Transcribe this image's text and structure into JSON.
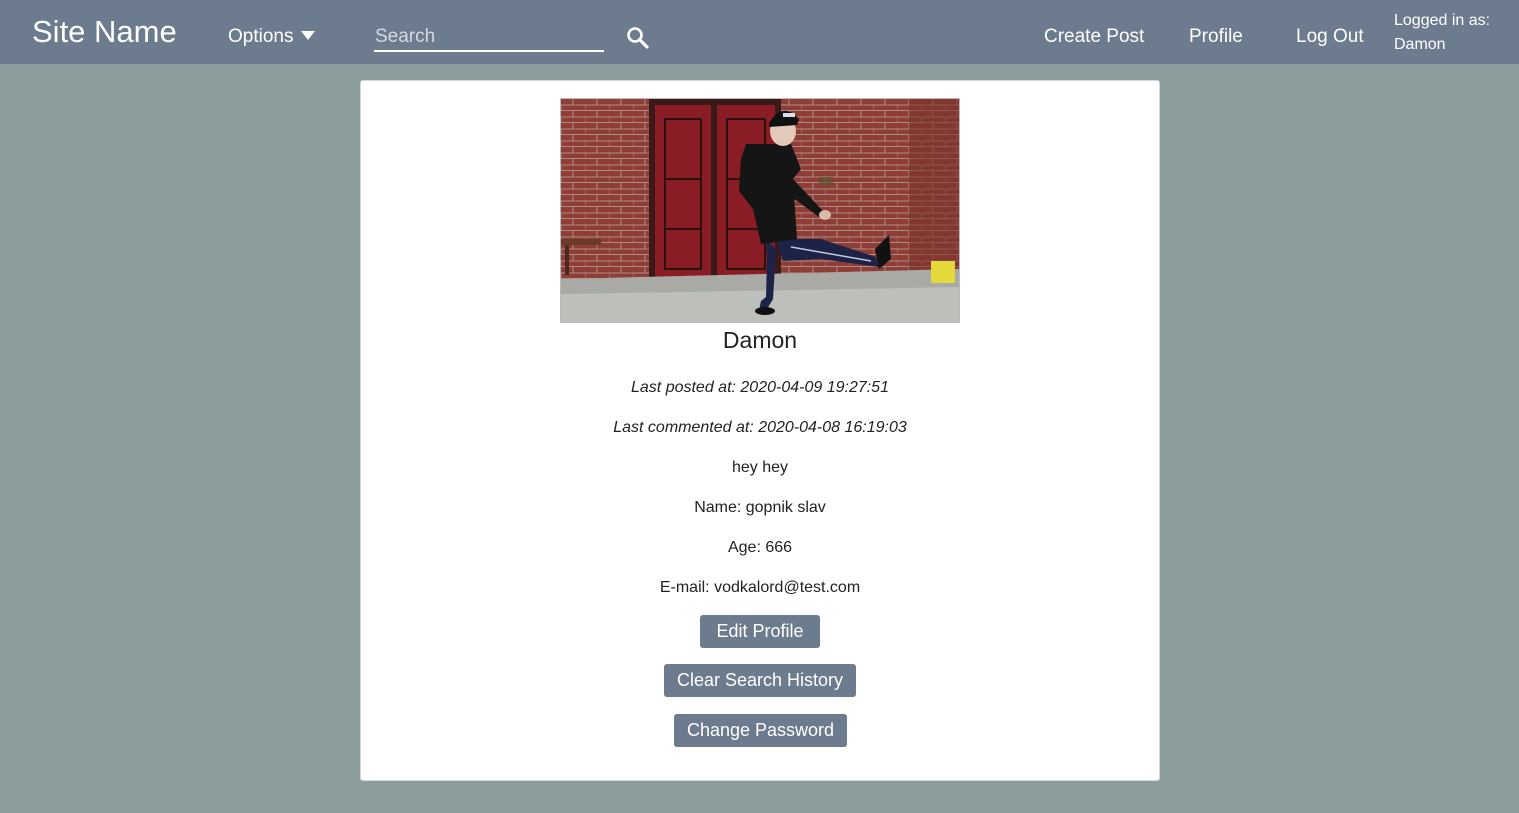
{
  "nav": {
    "brand": "Site Name",
    "options_label": "Options",
    "search_placeholder": "Search",
    "create_post": "Create Post",
    "profile": "Profile",
    "logout": "Log Out",
    "logged_in_label": "Logged in as:",
    "logged_in_user": "Damon"
  },
  "profile": {
    "username": "Damon",
    "last_posted": "Last posted at: 2020-04-09 19:27:51",
    "last_commented": "Last commented at: 2020-04-08 16:19:03",
    "bio": "hey hey",
    "name": "Name: gopnik slav",
    "age": "Age: 666",
    "email": "E-mail: vodkalord@test.com",
    "edit_profile": "Edit Profile",
    "clear_search_history": "Clear Search History",
    "change_password": "Change Password"
  },
  "colors": {
    "navbar": "#6c7b8d",
    "background": "#8c9d9e",
    "button": "#6c7b8d"
  },
  "icons": {
    "search": "search-icon",
    "options_caret": "caret-down-icon"
  }
}
